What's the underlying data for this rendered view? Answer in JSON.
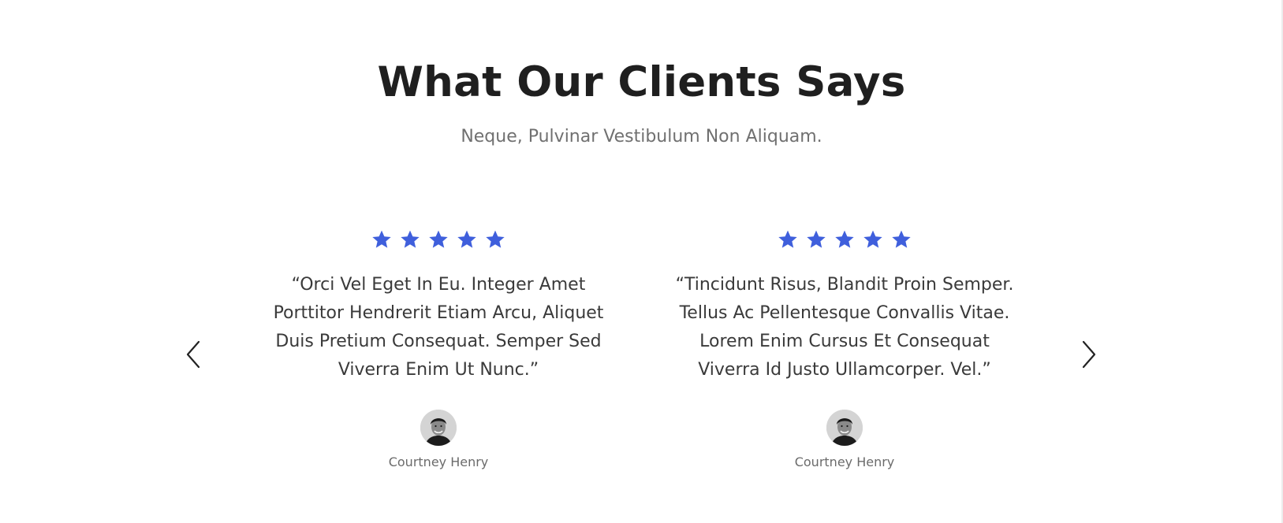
{
  "section": {
    "title": "What Our Clients Says",
    "subtitle": "Neque, Pulvinar Vestibulum Non Aliquam."
  },
  "colors": {
    "star": "#3f5fdc",
    "title": "#1f1f1f",
    "subtitle": "#707070",
    "quote": "#3a3a3a"
  },
  "carousel": {
    "prev_icon": "chevron-left-icon",
    "next_icon": "chevron-right-icon"
  },
  "testimonials": [
    {
      "rating": 5,
      "quote": "“Orci Vel Eget In Eu. Integer Amet Porttitor Hendrerit Etiam Arcu, Aliquet Duis Pretium Consequat. Semper Sed Viverra Enim Ut Nunc.”",
      "author": "Courtney Henry",
      "avatar_icon": "user-avatar"
    },
    {
      "rating": 5,
      "quote": "“Tincidunt Risus, Blandit Proin Semper. Tellus Ac Pellentesque Convallis Vitae. Lorem Enim Cursus Et Consequat Viverra Id Justo Ullamcorper. Vel.”",
      "author": "Courtney Henry",
      "avatar_icon": "user-avatar"
    }
  ]
}
